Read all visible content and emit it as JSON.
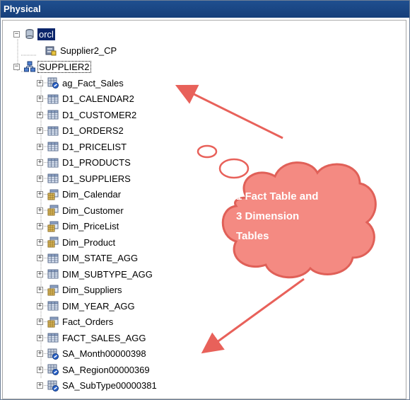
{
  "window": {
    "title": "Physical"
  },
  "tree": {
    "database": {
      "label": "orcl",
      "icon": "database-icon"
    },
    "connection_pool": {
      "label": "Supplier2_CP",
      "icon": "connection-pool-icon"
    },
    "schema": {
      "label": "SUPPLIER2",
      "icon": "schema-icon"
    },
    "tables": [
      {
        "label": "ag_Fact_Sales",
        "icon": "aggregate-table-icon"
      },
      {
        "label": "D1_CALENDAR2",
        "icon": "physical-table-icon"
      },
      {
        "label": "D1_CUSTOMER2",
        "icon": "physical-table-icon"
      },
      {
        "label": "D1_ORDERS2",
        "icon": "physical-table-icon"
      },
      {
        "label": "D1_PRICELIST",
        "icon": "physical-table-icon"
      },
      {
        "label": "D1_PRODUCTS",
        "icon": "physical-table-icon"
      },
      {
        "label": "D1_SUPPLIERS",
        "icon": "physical-table-icon"
      },
      {
        "label": "Dim_Calendar",
        "icon": "alias-table-icon"
      },
      {
        "label": "Dim_Customer",
        "icon": "alias-table-icon"
      },
      {
        "label": "Dim_PriceList",
        "icon": "alias-table-icon"
      },
      {
        "label": "Dim_Product",
        "icon": "alias-table-icon"
      },
      {
        "label": "DIM_STATE_AGG",
        "icon": "physical-table-icon"
      },
      {
        "label": "DIM_SUBTYPE_AGG",
        "icon": "physical-table-icon"
      },
      {
        "label": "Dim_Suppliers",
        "icon": "alias-table-icon"
      },
      {
        "label": "DIM_YEAR_AGG",
        "icon": "physical-table-icon"
      },
      {
        "label": "Fact_Orders",
        "icon": "alias-table-icon"
      },
      {
        "label": "FACT_SALES_AGG",
        "icon": "physical-table-icon"
      },
      {
        "label": "SA_Month00000398",
        "icon": "aggregate-table-icon"
      },
      {
        "label": "SA_Region00000369",
        "icon": "aggregate-table-icon"
      },
      {
        "label": "SA_SubType00000381",
        "icon": "aggregate-table-icon"
      }
    ]
  },
  "callout": {
    "line1": "1 Fact Table and",
    "line2": "3 Dimension",
    "line3": "Tables"
  },
  "colors": {
    "arrow": "#e8615a",
    "cloud_fill": "#f48a82",
    "cloud_stroke": "#e06058",
    "title_bg": "#1f4f8f"
  }
}
